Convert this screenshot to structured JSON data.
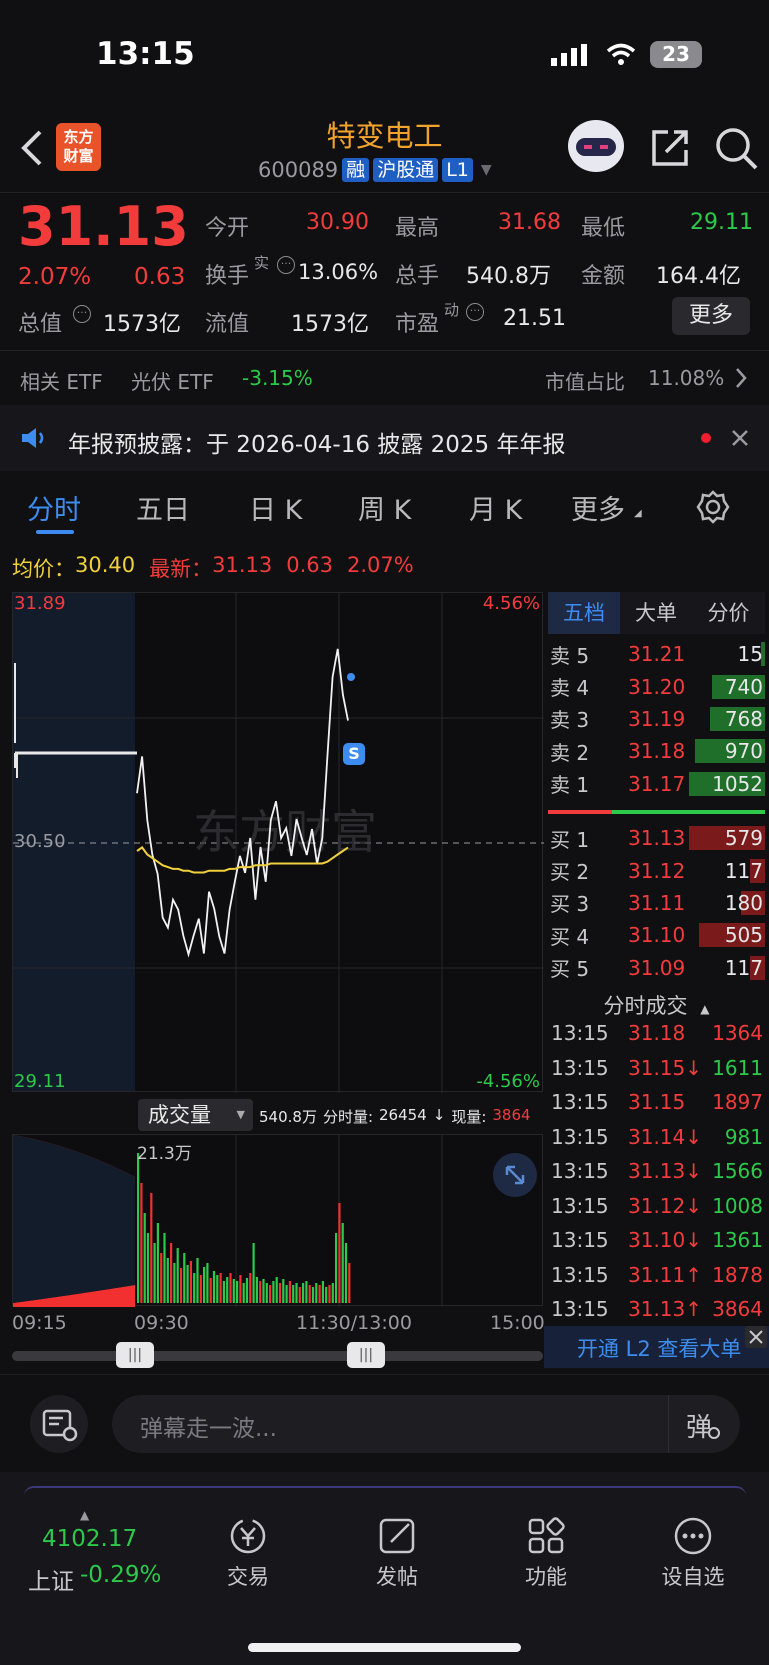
{
  "status_bar": {
    "time": "13:15",
    "battery": "23"
  },
  "header": {
    "title": "特变电工",
    "code": "600089",
    "badges": [
      "融",
      "沪股通",
      "L1"
    ],
    "logo": "东方\n财富"
  },
  "quote": {
    "price": "31.13",
    "change_pct": "2.07%",
    "change": "0.63",
    "open_label": "今开",
    "open": "30.90",
    "high_label": "最高",
    "high": "31.68",
    "low_label": "最低",
    "low": "29.11",
    "turnover_label": "换手",
    "turnover_sup": "实",
    "turnover": "13.06%",
    "volume_label": "总手",
    "volume": "540.8万",
    "amount_label": "金额",
    "amount": "164.4亿",
    "mktcap_label": "总值",
    "mktcap": "1573亿",
    "float_label": "流值",
    "float_cap": "1573亿",
    "pe_label": "市盈",
    "pe_sup": "动",
    "pe": "21.51",
    "more_button": "更多"
  },
  "etf_bar": {
    "label": "相关 ETF",
    "etf_name": "光伏 ETF",
    "etf_change": "-3.15%",
    "ratio_label": "市值占比",
    "ratio": "11.08%"
  },
  "notice": {
    "text": "年报预披露：于 2026-04-16 披露 2025 年年报"
  },
  "tabs": [
    "分时",
    "五日",
    "日 K",
    "周 K",
    "月 K",
    "更多"
  ],
  "summary": {
    "avg_label": "均价：",
    "avg": "30.40",
    "last_label": "最新：",
    "last": "31.13",
    "chg": "0.63",
    "pct": "2.07%"
  },
  "chart_data": {
    "type": "line",
    "y_top": "31.89",
    "y_mid": "30.50",
    "y_bottom": "29.11",
    "pct_top": "4.56%",
    "pct_bottom": "-4.56%",
    "x_labels": [
      "09:15",
      "09:30",
      "11:30/13:00",
      "15:00"
    ],
    "vol_header": "成交量",
    "vol_total": "540.8万",
    "vol_detail_label": "分时量:",
    "vol_detail": "26454",
    "cur_label": "现量:",
    "cur_vol": "3864",
    "vol_peak": "21.3万",
    "series": [
      {
        "values": [
          30.75,
          31.0,
          30.6,
          30.45,
          30.3,
          30.1,
          30.0,
          30.2,
          30.1,
          30.0,
          29.85,
          30.0,
          30.05,
          29.9,
          30.2,
          30.15,
          29.95,
          29.9,
          30.1,
          30.3,
          30.4,
          30.35,
          30.5,
          30.2,
          30.45,
          30.3,
          30.6,
          30.75,
          30.5,
          30.6,
          30.4,
          30.65,
          30.5,
          30.45,
          30.55,
          30.4,
          30.5,
          31.0,
          31.4,
          31.6,
          31.3,
          31.2
        ]
      },
      {
        "values": [
          30.45,
          30.47,
          30.43,
          30.41,
          30.39,
          30.37,
          30.36,
          30.35,
          30.35,
          30.34,
          30.34,
          30.33,
          30.33,
          30.33,
          30.34,
          30.34,
          30.34,
          30.34,
          30.35,
          30.35,
          30.36,
          30.36,
          30.36,
          30.37,
          30.37,
          30.37,
          30.38,
          30.38,
          30.38,
          30.38,
          30.38,
          30.38,
          30.38,
          30.38,
          30.38,
          30.38,
          30.38,
          30.39,
          30.41,
          30.43,
          30.45,
          30.47
        ]
      }
    ]
  },
  "order_book": {
    "tabs": [
      "五档",
      "大单",
      "分价"
    ],
    "asks": [
      {
        "label": "卖 5",
        "price": "31.21",
        "vol": "15"
      },
      {
        "label": "卖 4",
        "price": "31.20",
        "vol": "740"
      },
      {
        "label": "卖 3",
        "price": "31.19",
        "vol": "768"
      },
      {
        "label": "卖 2",
        "price": "31.18",
        "vol": "970"
      },
      {
        "label": "卖 1",
        "price": "31.17",
        "vol": "1052"
      }
    ],
    "bids": [
      {
        "label": "买 1",
        "price": "31.13",
        "vol": "579"
      },
      {
        "label": "买 2",
        "price": "31.12",
        "vol": "117"
      },
      {
        "label": "买 3",
        "price": "31.11",
        "vol": "180"
      },
      {
        "label": "买 4",
        "price": "31.10",
        "vol": "505"
      },
      {
        "label": "买 5",
        "price": "31.09",
        "vol": "117"
      }
    ]
  },
  "ticks": {
    "title": "分时成交",
    "rows": [
      {
        "t": "13:15",
        "p": "31.18",
        "v": "1364",
        "vc": "red"
      },
      {
        "t": "13:15",
        "p": "31.15↓",
        "v": "1611",
        "vc": "green"
      },
      {
        "t": "13:15",
        "p": "31.15",
        "v": "1897",
        "vc": "red"
      },
      {
        "t": "13:15",
        "p": "31.14↓",
        "v": "981",
        "vc": "green"
      },
      {
        "t": "13:15",
        "p": "31.13↓",
        "v": "1566",
        "vc": "green"
      },
      {
        "t": "13:15",
        "p": "31.12↓",
        "v": "1008",
        "vc": "green"
      },
      {
        "t": "13:15",
        "p": "31.10↓",
        "v": "1361",
        "vc": "green"
      },
      {
        "t": "13:15",
        "p": "31.11↑",
        "v": "1878",
        "vc": "red"
      },
      {
        "t": "13:15",
        "p": "31.13↑",
        "v": "3864",
        "vc": "red"
      }
    ],
    "l2_banner": "开通 L2 查看大单"
  },
  "danmaku": {
    "placeholder": "弹幕走一波..."
  },
  "bottom_nav": {
    "index_value": "4102.17",
    "index_name": "上证",
    "index_change": "-0.29%",
    "items": [
      "交易",
      "发帖",
      "功能",
      "设自选"
    ]
  }
}
